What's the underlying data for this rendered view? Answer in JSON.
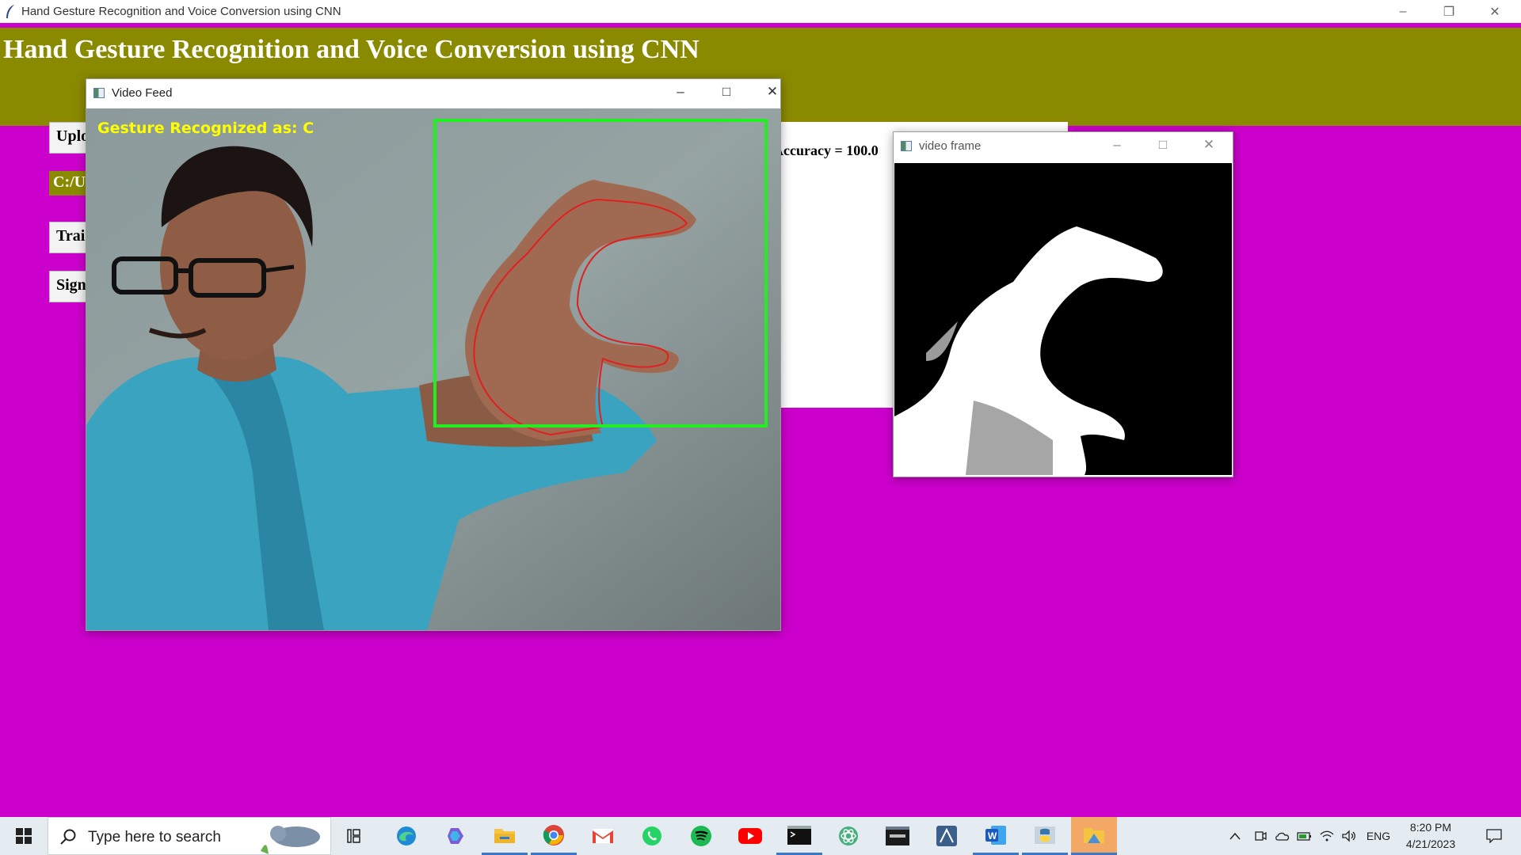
{
  "main_window": {
    "title": "Hand Gesture Recognition and Voice Conversion using CNN",
    "heading": "Hand Gesture Recognition and Voice Conversion using CNN",
    "buttons": [
      "Upload",
      "Train",
      "Sign"
    ],
    "path_label": "C:/U",
    "result_text": "Accuracy = 100.0",
    "colors": {
      "background": "#cc00cc",
      "header": "#8a8a00"
    }
  },
  "video_feed_window": {
    "title": "Video Feed",
    "overlay_text": "Gesture Recognized as: C",
    "roi_color": "#22ee22",
    "contour_color": "#e02020"
  },
  "video_frame_window": {
    "title": "video frame"
  },
  "taskbar": {
    "search_placeholder": "Type here to search",
    "apps": [
      "task-view",
      "edge",
      "copilot",
      "file-explorer",
      "chrome",
      "gmail",
      "whatsapp",
      "spotify",
      "youtube",
      "terminal",
      "atom",
      "mysql",
      "sql-developer",
      "word",
      "python",
      "file-manager"
    ],
    "language": "ENG",
    "time": "8:20 PM",
    "date": "4/21/2023"
  }
}
